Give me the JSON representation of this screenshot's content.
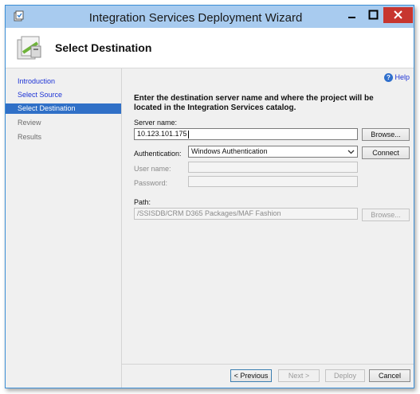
{
  "window": {
    "title": "Integration Services Deployment Wizard"
  },
  "header": {
    "title": "Select Destination"
  },
  "sidebar": {
    "items": [
      {
        "label": "Introduction",
        "state": "link"
      },
      {
        "label": "Select Source",
        "state": "link"
      },
      {
        "label": "Select Destination",
        "state": "active"
      },
      {
        "label": "Review",
        "state": "disabled"
      },
      {
        "label": "Results",
        "state": "disabled"
      }
    ]
  },
  "main": {
    "help_label": "Help",
    "instructions": "Enter the destination server name and where the project will be located in the Integration Services catalog.",
    "server_name_label": "Server name:",
    "server_name_value": "10.123.101.175",
    "browse_label": "Browse...",
    "authentication_label": "Authentication:",
    "authentication_value": "Windows Authentication",
    "connect_label": "Connect",
    "username_label": "User name:",
    "username_value": "",
    "password_label": "Password:",
    "password_value": "",
    "path_label": "Path:",
    "path_value": "/SSISDB/CRM D365 Packages/MAF Fashion",
    "path_browse_label": "Browse..."
  },
  "footer": {
    "previous_label": "< Previous",
    "next_label": "Next >",
    "deploy_label": "Deploy",
    "cancel_label": "Cancel"
  },
  "colors": {
    "titlebar": "#a8cbef",
    "close_button": "#c7362f",
    "nav_active": "#3070c7",
    "link": "#1e34d6"
  }
}
